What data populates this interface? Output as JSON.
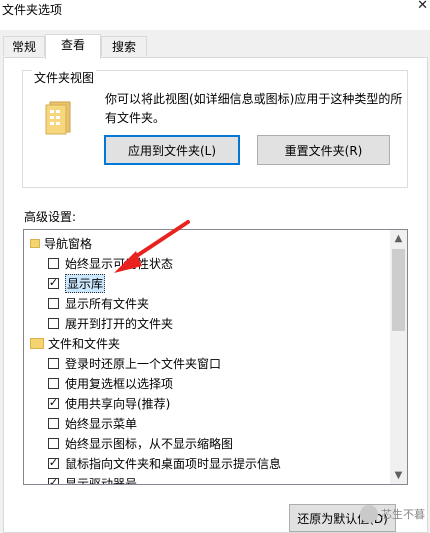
{
  "window": {
    "title": "文件夹选项",
    "close_glyph": "✕"
  },
  "tabs": [
    {
      "label": "常规"
    },
    {
      "label": "查看"
    },
    {
      "label": "搜索"
    }
  ],
  "folder_views": {
    "label": "文件夹视图",
    "description": "你可以将此视图(如详细信息或图标)应用于这种类型的所有文件夹。",
    "apply_button": "应用到文件夹(L)",
    "reset_button": "重置文件夹(R)"
  },
  "advanced": {
    "label": "高级设置:",
    "items": [
      {
        "type": "folder",
        "label": "导航窗格",
        "checked": null
      },
      {
        "type": "checkbox",
        "label": "始终显示可用性状态",
        "checked": false
      },
      {
        "type": "checkbox",
        "label": "显示库",
        "checked": true
      },
      {
        "type": "checkbox",
        "label": "显示所有文件夹",
        "checked": false
      },
      {
        "type": "checkbox",
        "label": "展开到打开的文件夹",
        "checked": false
      },
      {
        "type": "folder",
        "label": "文件和文件夹",
        "checked": null
      },
      {
        "type": "checkbox",
        "label": "登录时还原上一个文件夹窗口",
        "checked": false
      },
      {
        "type": "checkbox",
        "label": "使用复选框以选择项",
        "checked": false
      },
      {
        "type": "checkbox",
        "label": "使用共享向导(推荐)",
        "checked": true
      },
      {
        "type": "checkbox",
        "label": "始终显示菜单",
        "checked": false
      },
      {
        "type": "checkbox",
        "label": "始终显示图标，从不显示缩略图",
        "checked": false
      },
      {
        "type": "checkbox",
        "label": "鼠标指向文件夹和桌面项时显示提示信息",
        "checked": true
      },
      {
        "type": "checkbox",
        "label": "显示驱动器号",
        "checked": true
      }
    ]
  },
  "restore_button": "还原为默认值(D)",
  "watermark": "芯生不暮",
  "colors": {
    "accent": "#0078d7",
    "arrow": "#e8231f"
  }
}
